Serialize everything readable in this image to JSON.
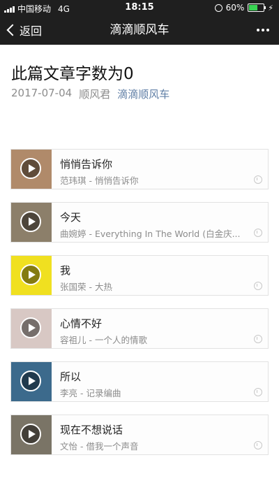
{
  "status": {
    "carrier": "中国移动",
    "network": "4G",
    "time": "18:15",
    "battery_text": "60%",
    "battery_level": 0.6,
    "battery_color": "#39d353"
  },
  "nav": {
    "back_label": "返回",
    "title": "滴滴顺风车",
    "more_icon": "more-dots-icon"
  },
  "article": {
    "title": "此篇文章字数为0",
    "date": "2017-07-04",
    "author": "顺风君",
    "account": "滴滴顺风车",
    "link_color": "#607fa6"
  },
  "songs": [
    {
      "title": "悄悄告诉你",
      "artist": "范玮琪 - 悄悄告诉你",
      "cover_color": "#b08a6a"
    },
    {
      "title": "今天",
      "artist": "曲婉婷 - Everything In The World (白金庆...",
      "cover_color": "#8c7f6a"
    },
    {
      "title": "我",
      "artist": "张国荣 - 大热",
      "cover_color": "#f0e020"
    },
    {
      "title": "心情不好",
      "artist": "容祖儿 - 一个人的情歌",
      "cover_color": "#d8c8c4"
    },
    {
      "title": "所以",
      "artist": "李亮 - 记录编曲",
      "cover_color": "#3c6a8c"
    },
    {
      "title": "现在不想说话",
      "artist": "文怡 - 借我一个声音",
      "cover_color": "#7a7466"
    }
  ]
}
